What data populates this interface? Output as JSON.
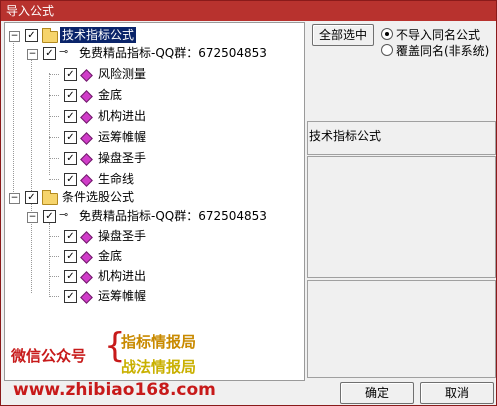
{
  "window": {
    "title": "导入公式"
  },
  "tree": {
    "root1": {
      "label": "技术指标公式",
      "group": {
        "label": "免费精品指标-QQ群：672504853",
        "items": [
          "风险测量",
          "金底",
          "机构进出",
          "运筹帷幄",
          "操盘圣手",
          "生命线"
        ]
      }
    },
    "root2": {
      "label": "条件选股公式",
      "group": {
        "label": "免费精品指标-QQ群：672504853",
        "items": [
          "操盘圣手",
          "金底",
          "机构进出",
          "运筹帷幄"
        ]
      }
    }
  },
  "controls": {
    "select_all": "全部选中",
    "option1": "不导入同名公式",
    "option2": "覆盖同名(非系统)",
    "selected_option": "option1",
    "info_label": "技术指标公式",
    "ok": "确定",
    "cancel": "取消"
  },
  "watermark": {
    "label": "微信公众号",
    "line1": "指标情报局",
    "line2": "战法情报局",
    "url": "www.zhibiao168.com"
  }
}
